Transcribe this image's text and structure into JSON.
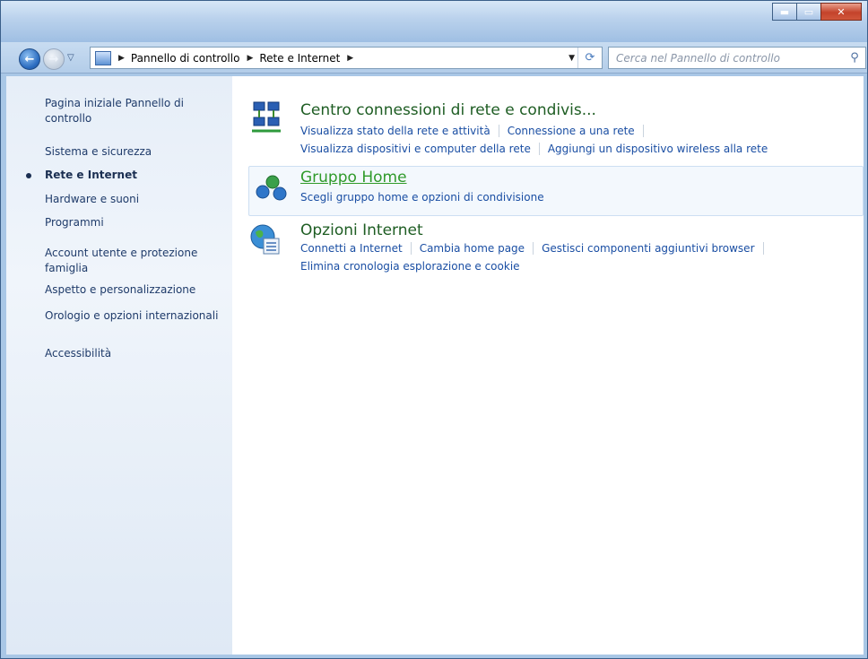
{
  "window": {
    "caption": {
      "minimize_icon": "minimize-icon",
      "maximize_icon": "maximize-icon",
      "close_icon": "close-icon"
    }
  },
  "address": {
    "breadcrumbs": [
      "Pannello di controllo",
      "Rete e Internet"
    ],
    "search_placeholder": "Cerca nel Pannello di controllo"
  },
  "sidebar": {
    "items": [
      {
        "label": "Pagina iniziale Pannello di controllo"
      },
      {
        "label": "Sistema e sicurezza"
      },
      {
        "label": "Rete e Internet",
        "current": true
      },
      {
        "label": "Hardware e suoni"
      },
      {
        "label": "Programmi"
      },
      {
        "label": "Account utente e protezione famiglia"
      },
      {
        "label": "Aspetto e personalizzazione"
      },
      {
        "label": "Orologio e opzioni internazionali"
      },
      {
        "label": "Accessibilità"
      }
    ]
  },
  "categories": [
    {
      "title": "Centro connessioni di rete e condivis...",
      "icon": "network-center-icon",
      "links_row1": [
        "Visualizza stato della rete e attività",
        "Connessione a una rete"
      ],
      "links_row2": [
        "Visualizza dispositivi e computer della rete",
        "Aggiungi un dispositivo wireless alla rete"
      ]
    },
    {
      "title": "Gruppo Home",
      "icon": "homegroup-icon",
      "links_row1": [
        "Scegli gruppo home e opzioni di condivisione"
      ]
    },
    {
      "title": "Opzioni Internet",
      "icon": "internet-options-icon",
      "links_row1": [
        "Connetti a Internet",
        "Cambia home page",
        "Gestisci componenti aggiuntivi browser"
      ],
      "links_row2": [
        "Elimina cronologia esplorazione e cookie"
      ]
    }
  ],
  "colors": {
    "link": "#1a4ea3",
    "category_title": "#1e5d23",
    "hover_title": "#2f9a2a"
  }
}
